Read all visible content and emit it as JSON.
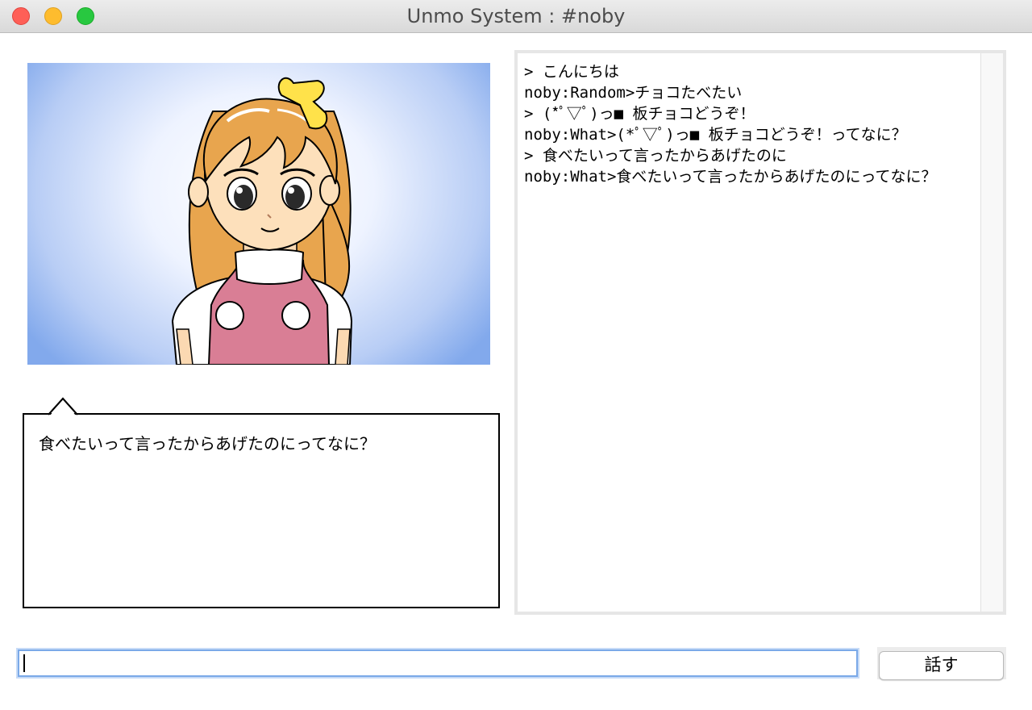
{
  "window": {
    "title": "Unmo System : #noby"
  },
  "speech_bubble": {
    "text": "食べたいって言ったからあげたのにってなに？"
  },
  "log": {
    "lines": [
      "> こんにちは",
      "noby:Random>チョコたべたい",
      "> (*ﾟ▽ﾟ)っ■ 板チョコどうぞ！",
      "noby:What>(*ﾟ▽ﾟ)っ■ 板チョコどうぞ！ってなに？",
      "> 食べたいって言ったからあげたのに",
      "noby:What>食べたいって言ったからあげたのにってなに？"
    ]
  },
  "input": {
    "value": "",
    "placeholder": ""
  },
  "speak_button": {
    "label": "話す"
  },
  "colors": {
    "portrait_background": "#82a9ec",
    "input_focus": "#7aa9e8",
    "close": "#fe5f57",
    "minimize": "#febc2e",
    "zoom": "#28c840"
  }
}
